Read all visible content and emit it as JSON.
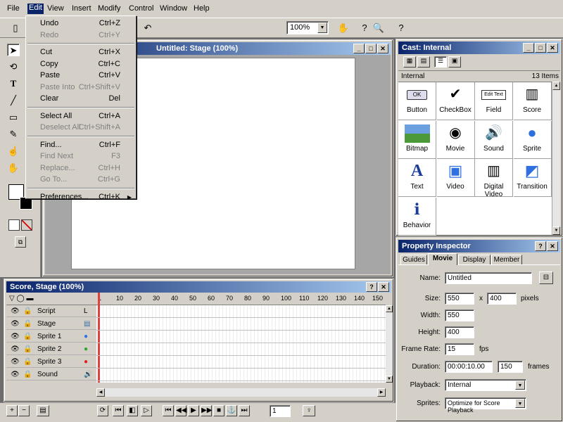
{
  "menubar": [
    "File",
    "Edit",
    "View",
    "Insert",
    "Modify",
    "Control",
    "Window",
    "Help"
  ],
  "toolbar": {
    "zoom": "100%"
  },
  "edit_menu": {
    "items": [
      {
        "label": "Undo",
        "shortcut": "Ctrl+Z",
        "enabled": true
      },
      {
        "label": "Redo",
        "shortcut": "Ctrl+Y",
        "enabled": false
      },
      {
        "sep": true
      },
      {
        "label": "Cut",
        "shortcut": "Ctrl+X",
        "enabled": true
      },
      {
        "label": "Copy",
        "shortcut": "Ctrl+C",
        "enabled": true
      },
      {
        "label": "Paste",
        "shortcut": "Ctrl+V",
        "enabled": true
      },
      {
        "label": "Paste Into",
        "shortcut": "Ctrl+Shift+V",
        "enabled": false
      },
      {
        "label": "Clear",
        "shortcut": "Del",
        "enabled": true
      },
      {
        "sep": true
      },
      {
        "label": "Select All",
        "shortcut": "Ctrl+A",
        "enabled": true
      },
      {
        "label": "Deselect All",
        "shortcut": "Ctrl+Shift+A",
        "enabled": false
      },
      {
        "sep": true
      },
      {
        "label": "Find...",
        "shortcut": "Ctrl+F",
        "enabled": true
      },
      {
        "label": "Find Next",
        "shortcut": "F3",
        "enabled": false
      },
      {
        "label": "Replace...",
        "shortcut": "Ctrl+H",
        "enabled": false
      },
      {
        "label": "Go To...",
        "shortcut": "Ctrl+G",
        "enabled": false
      },
      {
        "sep": true
      },
      {
        "label": "Preferences...",
        "shortcut": "Ctrl+K",
        "enabled": true,
        "submenu": true
      }
    ]
  },
  "stage": {
    "title": "Untitled: Stage (100%)"
  },
  "cast": {
    "title": "Cast: Internal",
    "name": "Internal",
    "count": "13 Items",
    "members": [
      {
        "label": "Button",
        "icon": "ok-button-icon",
        "glyph": "OK"
      },
      {
        "label": "CheckBox",
        "icon": "checkbox-icon",
        "glyph": "✔"
      },
      {
        "label": "Field",
        "icon": "edit-text-icon",
        "glyph": "Edit Text"
      },
      {
        "label": "Score",
        "icon": "filmstrip-icon",
        "glyph": "▥"
      },
      {
        "label": "Bitmap",
        "icon": "landscape-icon",
        "glyph": ""
      },
      {
        "label": "Movie",
        "icon": "film-reel-icon",
        "glyph": "◉"
      },
      {
        "label": "Sound",
        "icon": "speaker-icon",
        "glyph": "🔊"
      },
      {
        "label": "Sprite",
        "icon": "blue-circle-icon",
        "glyph": "●"
      },
      {
        "label": "Text",
        "icon": "letter-a-icon",
        "glyph": "A"
      },
      {
        "label": "Video",
        "icon": "monitor-icon",
        "glyph": "▣"
      },
      {
        "label": "Digital Video",
        "icon": "filmstrip-icon",
        "glyph": "▥"
      },
      {
        "label": "Transition",
        "icon": "squares-icon",
        "glyph": "◩"
      },
      {
        "label": "Behavior",
        "icon": "info-icon",
        "glyph": "ℹ"
      }
    ]
  },
  "score": {
    "title": "Score, Stage (100%)",
    "frames": [
      "1",
      "10",
      "20",
      "30",
      "40",
      "50",
      "60",
      "70",
      "80",
      "90",
      "100",
      "110",
      "120",
      "130",
      "140",
      "150"
    ],
    "channels": [
      {
        "label": "Script",
        "marker": "L",
        "color": ""
      },
      {
        "label": "Stage",
        "marker": "▤",
        "color": "#3a6ea5"
      },
      {
        "label": "Sprite 1",
        "marker": "●",
        "color": "#2f6fe0"
      },
      {
        "label": "Sprite 2",
        "marker": "●",
        "color": "#2aa62a"
      },
      {
        "label": "Sprite 3",
        "marker": "●",
        "color": "#e02020"
      },
      {
        "label": "Sound",
        "marker": "🔊",
        "color": "#808080"
      }
    ],
    "frame_input": "1"
  },
  "inspector": {
    "title": "Property Inspector",
    "tabs": [
      "Guides",
      "Movie",
      "Display",
      "Member"
    ],
    "active_tab": "Movie",
    "fields": {
      "name_label": "Name:",
      "name": "Untitled",
      "size_label": "Size:",
      "size_w": "550",
      "size_x": "x",
      "size_h": "400",
      "size_unit": "pixels",
      "width_label": "Width:",
      "width": "550",
      "height_label": "Height:",
      "height": "400",
      "fps_label": "Frame Rate:",
      "fps": "15",
      "fps_unit": "fps",
      "duration_label": "Duration:",
      "duration": "00:00:10.00",
      "frames": "150",
      "frames_unit": "frames",
      "playback_label": "Playback:",
      "playback": "Internal",
      "sprites_label": "Sprites:",
      "sprites": "Optimize for Score Playback"
    }
  }
}
